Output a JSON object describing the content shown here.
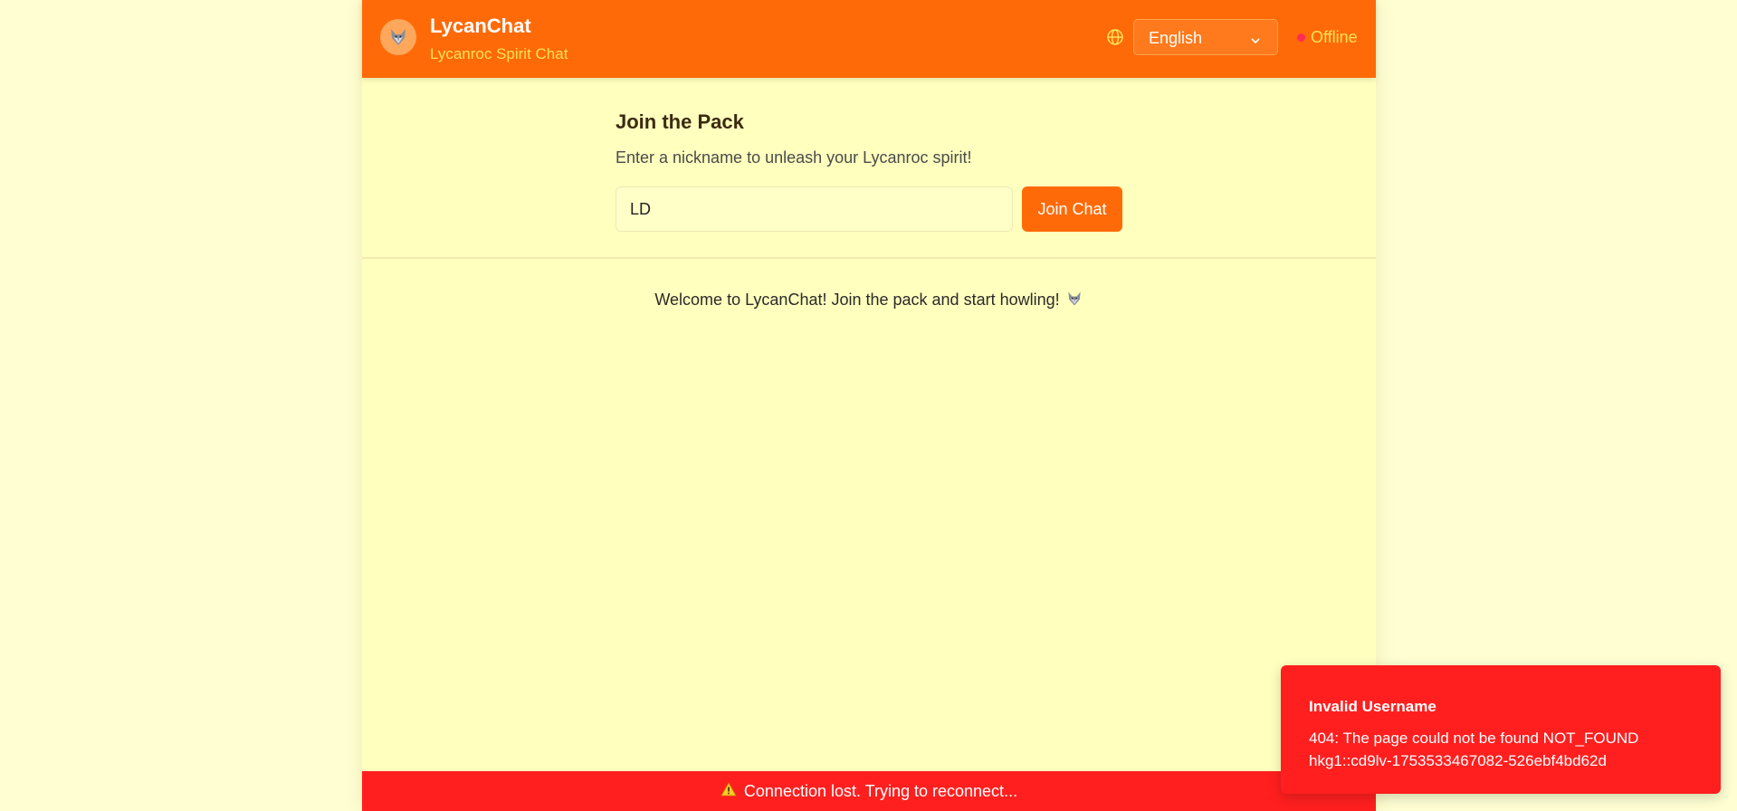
{
  "header": {
    "title": "LycanChat",
    "subtitle": "Lycanroc Spirit Chat",
    "language": "English",
    "status": "Offline"
  },
  "join": {
    "title": "Join the Pack",
    "description": "Enter a nickname to unleash your Lycanroc spirit!",
    "nickname_value": "LD",
    "button_label": "Join Chat"
  },
  "main": {
    "welcome": "Welcome to LycanChat! Join the pack and start howling!"
  },
  "banner": {
    "text": "Connection lost. Trying to reconnect..."
  },
  "toast": {
    "title": "Invalid Username",
    "message_line1": "404: The page could not be found NOT_FOUND",
    "message_line2": "hkg1::cd9lv-1753533467082-526ebf4bd62d"
  },
  "icons": {
    "avatar": "wolf-icon",
    "language": "globe-icon",
    "dropdown": "chevron-down-icon",
    "status": "status-dot",
    "welcome": "wolf-icon",
    "banner": "warning-icon"
  },
  "colors": {
    "accent": "#ff6a08",
    "page_background": "#fefed2",
    "panel_background": "#ffffbe",
    "subtitle": "#ffe05a",
    "error": "#ff1f1f",
    "status_offline": "#ff2d55"
  }
}
